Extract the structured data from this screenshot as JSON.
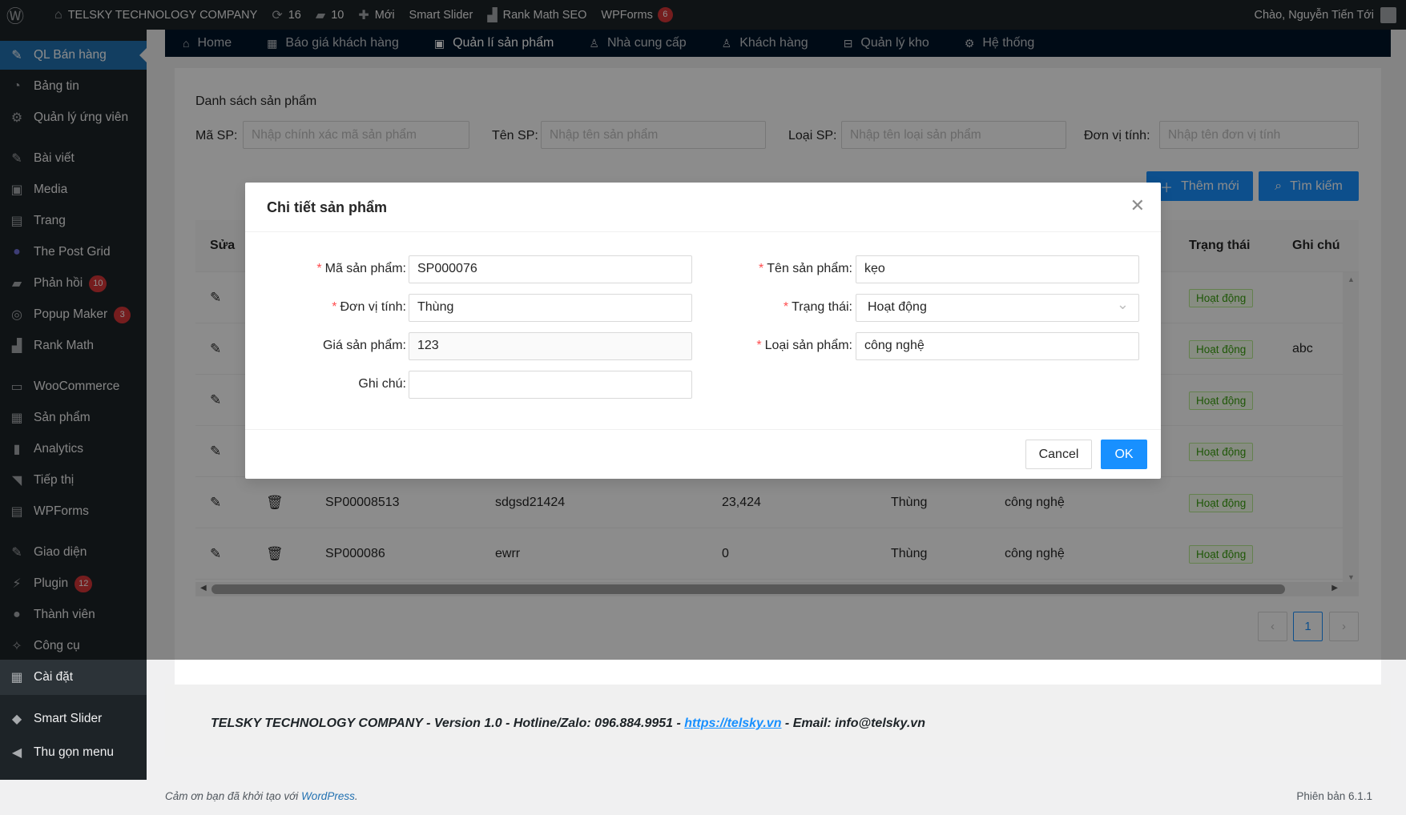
{
  "adminbar": {
    "site_name": "TELSKY TECHNOLOGY COMPANY",
    "updates_count": "16",
    "comments_count": "10",
    "new_label": "Mới",
    "smart_slider": "Smart Slider",
    "rank_math": "Rank Math SEO",
    "wpforms": "WPForms",
    "wpforms_badge": "6",
    "greeting": "Chào, Nguyễn Tiến Tới"
  },
  "sidebar": {
    "items": [
      {
        "label": "QL Bán hàng"
      },
      {
        "label": "Bảng tin"
      },
      {
        "label": "Quản lý ứng viên"
      },
      {
        "label": "Bài viết"
      },
      {
        "label": "Media"
      },
      {
        "label": "Trang"
      },
      {
        "label": "The Post Grid"
      },
      {
        "label": "Phản hồi",
        "badge": "10"
      },
      {
        "label": "Popup Maker",
        "badge": "3"
      },
      {
        "label": "Rank Math"
      },
      {
        "label": "WooCommerce"
      },
      {
        "label": "Sản phẩm"
      },
      {
        "label": "Analytics"
      },
      {
        "label": "Tiếp thị"
      },
      {
        "label": "WPForms"
      },
      {
        "label": "Giao diện"
      },
      {
        "label": "Plugin",
        "badge": "12"
      },
      {
        "label": "Thành viên"
      },
      {
        "label": "Công cụ"
      },
      {
        "label": "Cài đặt"
      },
      {
        "label": "Smart Slider"
      },
      {
        "label": "Thu gọn menu"
      }
    ]
  },
  "topnav": {
    "items": [
      "Home",
      "Báo giá khách hàng",
      "Quản lí sản phẩm",
      "Nhà cung cấp",
      "Khách hàng",
      "Quản lý kho",
      "Hệ thống"
    ]
  },
  "page": {
    "title": "Danh sách sản phẩm",
    "filters": [
      {
        "label": "Mã SP:",
        "placeholder": "Nhập chính xác mã sản phẩm"
      },
      {
        "label": "Tên SP:",
        "placeholder": "Nhập tên sản phẩm"
      },
      {
        "label": "Loại SP:",
        "placeholder": "Nhập tên loại sản phẩm"
      },
      {
        "label": "Đơn vị tính:",
        "placeholder": "Nhập tên đơn vị tính"
      }
    ],
    "add_button": "Thêm mới",
    "search_button": "Tìm kiếm"
  },
  "table": {
    "headers": {
      "edit": "Sửa",
      "status": "Trạng thái",
      "note": "Ghi chú"
    },
    "rows": [
      {
        "code": "",
        "name": "",
        "price": "",
        "unit": "",
        "type": "",
        "status": "Hoạt động",
        "note": ""
      },
      {
        "code": "",
        "name": "",
        "price": "",
        "unit": "",
        "type": "",
        "status": "Hoạt động",
        "note": "abc"
      },
      {
        "code": "",
        "name": "",
        "price": "",
        "unit": "",
        "type": "",
        "status": "Hoạt động",
        "note": ""
      },
      {
        "code": "",
        "name": "",
        "price": "",
        "unit": "",
        "type": "",
        "status": "Hoạt động",
        "note": ""
      },
      {
        "code": "SP00008513",
        "name": "sdgsd21424",
        "price": "23,424",
        "unit": "Thùng",
        "type": "công nghệ",
        "status": "Hoạt động",
        "note": ""
      },
      {
        "code": "SP000086",
        "name": "ewrr",
        "price": "0",
        "unit": "Thùng",
        "type": "công nghệ",
        "status": "Hoạt động",
        "note": ""
      }
    ]
  },
  "pagination": {
    "current": "1"
  },
  "footer": {
    "text_before": "TELSKY TECHNOLOGY COMPANY - Version 1.0 - Hotline/Zalo: 096.884.9951 - ",
    "link": "https://telsky.vn",
    "text_after": " - Email: info@telsky.vn",
    "wp_thanks": "Cảm ơn bạn đã khởi tạo với ",
    "wp_link": "WordPress",
    "version": "Phiên bản 6.1.1"
  },
  "modal": {
    "title": "Chi tiết sản phẩm",
    "fields": {
      "code_label": "Mã sản phẩm:",
      "code_value": "SP000076",
      "name_label": "Tên sản phẩm:",
      "name_value": "kẹo",
      "unit_label": "Đơn vị tính:",
      "unit_value": "Thùng",
      "status_label": "Trạng thái:",
      "status_value": "Hoạt động",
      "price_label": "Giá sản phẩm:",
      "price_value": "123",
      "type_label": "Loại sản phẩm:",
      "type_value": "công nghệ",
      "note_label": "Ghi chú:",
      "note_value": ""
    },
    "cancel": "Cancel",
    "ok": "OK"
  }
}
